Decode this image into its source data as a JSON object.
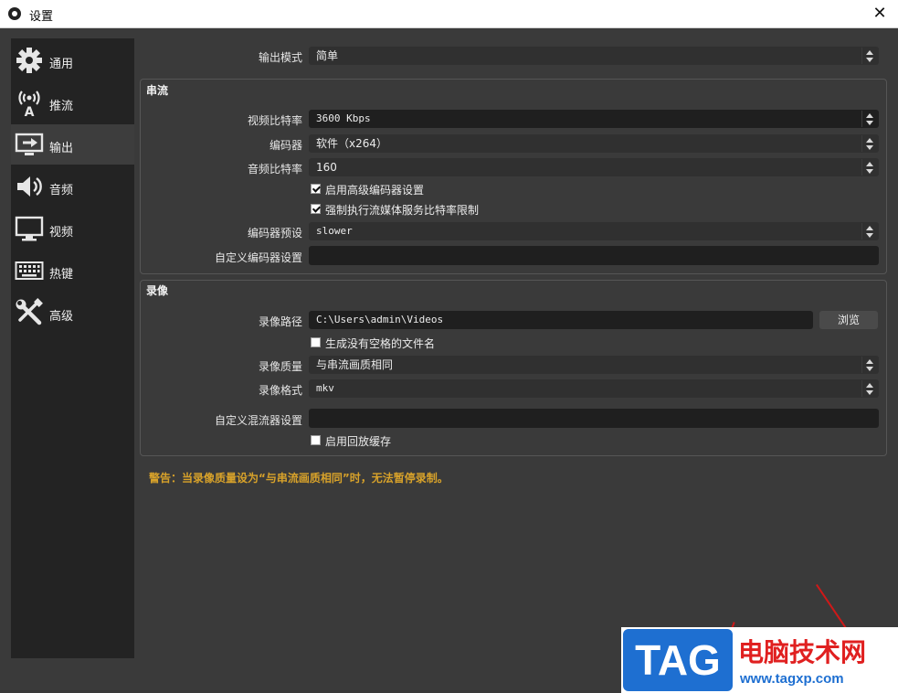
{
  "window": {
    "title": "设置"
  },
  "sidebar": {
    "items": [
      {
        "label": "通用",
        "icon": "gear-icon"
      },
      {
        "label": "推流",
        "icon": "antenna-icon"
      },
      {
        "label": "输出",
        "icon": "output-icon",
        "active": true
      },
      {
        "label": "音频",
        "icon": "speaker-icon"
      },
      {
        "label": "视频",
        "icon": "monitor-icon"
      },
      {
        "label": "热键",
        "icon": "keyboard-icon"
      },
      {
        "label": "高级",
        "icon": "tools-icon"
      }
    ]
  },
  "output_mode": {
    "label": "输出模式",
    "value": "简单"
  },
  "stream": {
    "title": "串流",
    "video_bitrate": {
      "label": "视频比特率",
      "value": "3600 Kbps"
    },
    "encoder": {
      "label": "编码器",
      "value": "软件（x264）"
    },
    "audio_bitrate": {
      "label": "音频比特率",
      "value": "160"
    },
    "advanced_encoder": {
      "label": "启用高级编码器设置",
      "checked": true
    },
    "enforce_limits": {
      "label": "强制执行流媒体服务比特率限制",
      "checked": true
    },
    "encoder_preset": {
      "label": "编码器预设",
      "value": "slower"
    },
    "custom_encoder": {
      "label": "自定义编码器设置",
      "value": ""
    }
  },
  "recording": {
    "title": "录像",
    "path": {
      "label": "录像路径",
      "value": "C:\\Users\\admin\\Videos",
      "browse_label": "浏览"
    },
    "no_space": {
      "label": "生成没有空格的文件名",
      "checked": false
    },
    "quality": {
      "label": "录像质量",
      "value": "与串流画质相同"
    },
    "format": {
      "label": "录像格式",
      "value": "mkv"
    },
    "custom_muxer": {
      "label": "自定义混流器设置",
      "value": ""
    },
    "replay_buffer": {
      "label": "启用回放缓存",
      "checked": false
    }
  },
  "warning": "警告：当录像质量设为“与串流画质相同”时，无法暂停录制。",
  "watermark": {
    "tag": "TAG",
    "name": "电脑技术网",
    "url": "www.tagxp.com"
  },
  "colors": {
    "warning": "#d8a22a",
    "background": "#3a3a3a",
    "sidebar": "#232323"
  }
}
